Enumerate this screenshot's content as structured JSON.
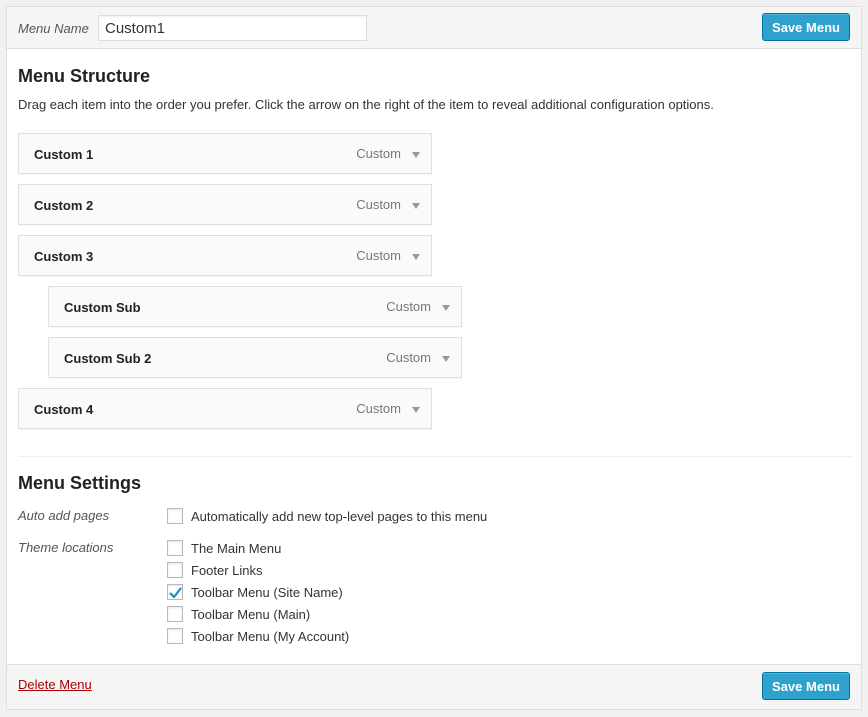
{
  "header": {
    "menu_name_label": "Menu Name",
    "menu_name_value": "Custom1",
    "save_label": "Save Menu"
  },
  "structure": {
    "title": "Menu Structure",
    "description": "Drag each item into the order you prefer. Click the arrow on the right of the item to reveal additional configuration options.",
    "items": [
      {
        "title": "Custom 1",
        "type": "Custom",
        "depth": 0
      },
      {
        "title": "Custom 2",
        "type": "Custom",
        "depth": 0
      },
      {
        "title": "Custom 3",
        "type": "Custom",
        "depth": 0
      },
      {
        "title": "Custom Sub",
        "type": "Custom",
        "depth": 1
      },
      {
        "title": "Custom Sub 2",
        "type": "Custom",
        "depth": 1
      },
      {
        "title": "Custom 4",
        "type": "Custom",
        "depth": 0
      }
    ]
  },
  "settings": {
    "title": "Menu Settings",
    "auto_add_label": "Auto add pages",
    "auto_add": {
      "label": "Automatically add new top-level pages to this menu",
      "checked": false
    },
    "theme_locations_label": "Theme locations",
    "locations": [
      {
        "label": "The Main Menu",
        "checked": false
      },
      {
        "label": "Footer Links",
        "checked": false
      },
      {
        "label": "Toolbar Menu (Site Name)",
        "checked": true
      },
      {
        "label": "Toolbar Menu (Main)",
        "checked": false
      },
      {
        "label": "Toolbar Menu (My Account)",
        "checked": false
      }
    ]
  },
  "footer": {
    "delete_label": "Delete Menu",
    "save_label": "Save Menu"
  },
  "colors": {
    "primary_button": "#2ea2cc",
    "delete_link": "#aa0000",
    "checkmark": "#1e8cbe"
  }
}
